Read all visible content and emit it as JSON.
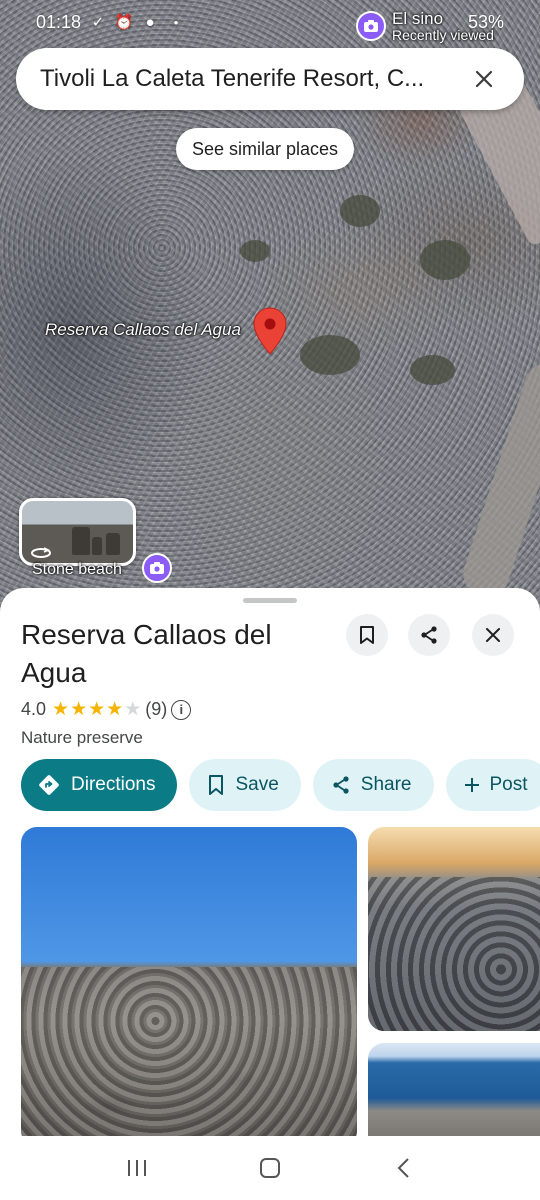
{
  "status_bar": {
    "time": "01:18",
    "battery": "53%",
    "left_icons": [
      "check-download-icon",
      "alarm-icon",
      "account-icon",
      "dot-icon"
    ],
    "right_icons": [
      "alarm-icon",
      "wifi-icon",
      "signal-icon",
      "battery-icon"
    ]
  },
  "search": {
    "query": "Tivoli La Caleta Tenerife Resort, C..."
  },
  "recently_viewed": {
    "title": "El sino",
    "subtitle": "Recently viewed"
  },
  "map": {
    "similar_places_label": "See similar places",
    "place_label": "Reserva Callaos del Agua",
    "thumbnail_label": "Stone beach"
  },
  "place": {
    "name": "Reserva Callaos del Agua",
    "rating": "4.0",
    "rating_stars": 4,
    "max_stars": 5,
    "review_count": "(9)",
    "category": "Nature preserve"
  },
  "actions": [
    {
      "label": "Directions",
      "icon": "directions-icon"
    },
    {
      "label": "Save",
      "icon": "bookmark-icon"
    },
    {
      "label": "Share",
      "icon": "share-icon"
    },
    {
      "label": "Post",
      "icon": "plus-icon"
    }
  ],
  "colors": {
    "primary": "#0b7b86",
    "chip_bg": "#dff3f7",
    "star": "#f4b400",
    "pin": "#ea4335",
    "camera": "#8b5cf6"
  }
}
